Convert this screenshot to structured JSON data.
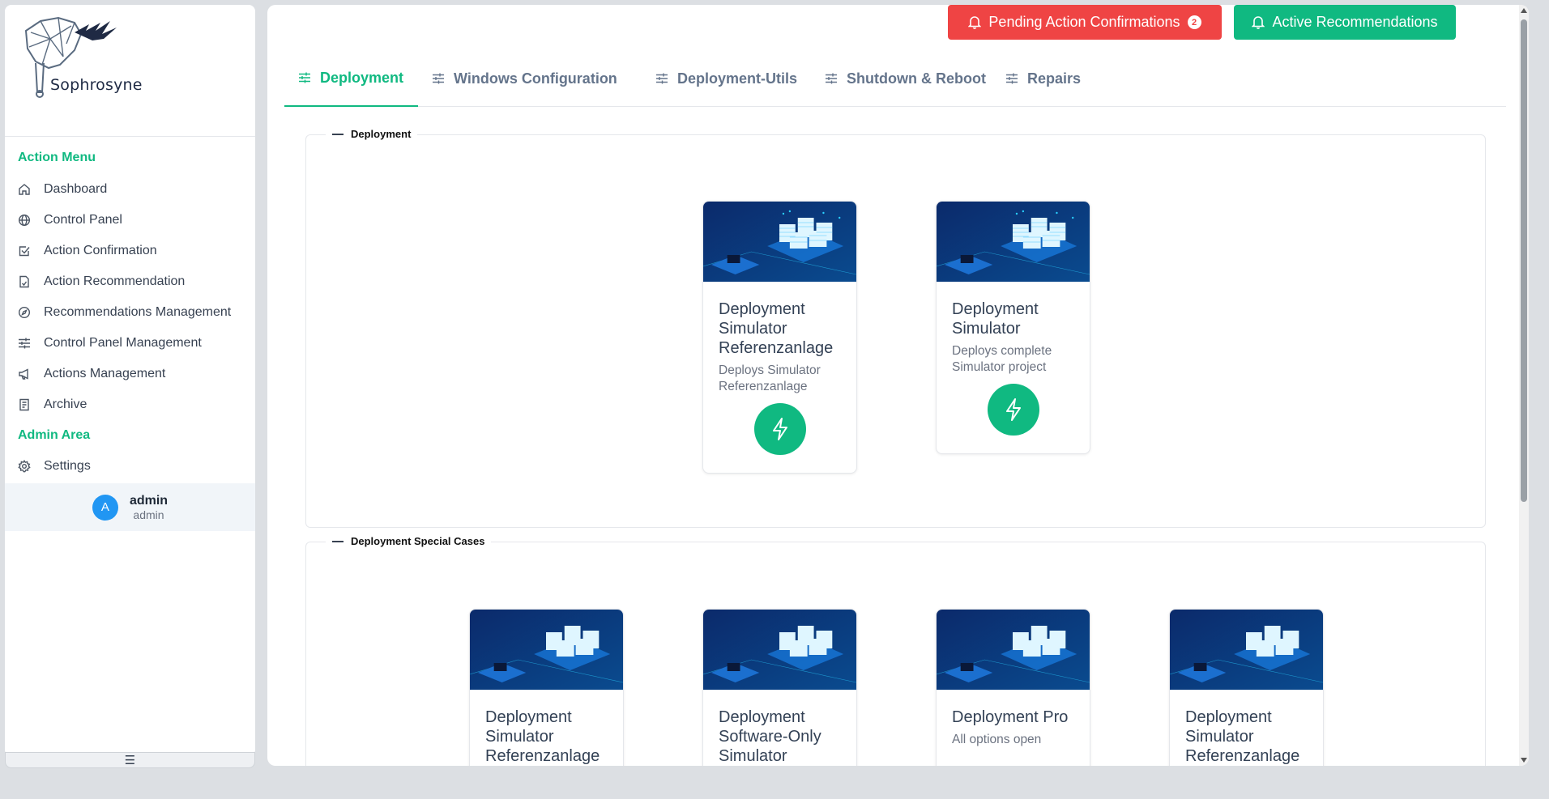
{
  "brand": {
    "name": "Sophrosyne"
  },
  "sidebar": {
    "sections": [
      {
        "title": "Action Menu"
      },
      {
        "title": "Admin Area"
      }
    ],
    "items": [
      {
        "label": "Dashboard",
        "icon": "home-icon"
      },
      {
        "label": "Control Panel",
        "icon": "globe-icon"
      },
      {
        "label": "Action Confirmation",
        "icon": "check-square-icon"
      },
      {
        "label": "Action Recommendation",
        "icon": "document-icon"
      },
      {
        "label": "Recommendations Management",
        "icon": "compass-icon"
      },
      {
        "label": "Control Panel Management",
        "icon": "sliders-icon"
      },
      {
        "label": "Actions Management",
        "icon": "megaphone-icon"
      },
      {
        "label": "Archive",
        "icon": "book-icon"
      },
      {
        "label": "Settings",
        "icon": "gear-icon"
      }
    ],
    "user": {
      "initial": "A",
      "name": "admin",
      "role": "admin"
    },
    "toggle_icon": "hamburger-icon"
  },
  "header": {
    "pending_label": "Pending Action Confirmations",
    "pending_count": "2",
    "active_label": "Active Recommendations"
  },
  "tabs": [
    {
      "label": "Deployment",
      "active": true
    },
    {
      "label": "Windows Configuration"
    },
    {
      "label": "Deployment-Utils"
    },
    {
      "label": "Shutdown & Reboot"
    },
    {
      "label": "Repairs"
    }
  ],
  "groups": [
    {
      "title": "Deployment",
      "cards": [
        {
          "title": "Deployment Simulator Referenzanlage",
          "desc": "Deploys Simulator Referenzanlage"
        },
        {
          "title": "Deployment Simulator",
          "desc": "Deploys complete Simulator project"
        }
      ]
    },
    {
      "title": "Deployment Special Cases",
      "cards": [
        {
          "title": "Deployment Simulator Referenzanlage"
        },
        {
          "title": "Deployment Software-Only Simulator"
        },
        {
          "title": "Deployment Pro",
          "desc": "All options open"
        },
        {
          "title": "Deployment Simulator Referenzanlage"
        }
      ]
    }
  ],
  "colors": {
    "accent": "#10b981",
    "danger": "#ef4444",
    "avatar": "#2196f3",
    "card_image": "#0b2a6b"
  }
}
